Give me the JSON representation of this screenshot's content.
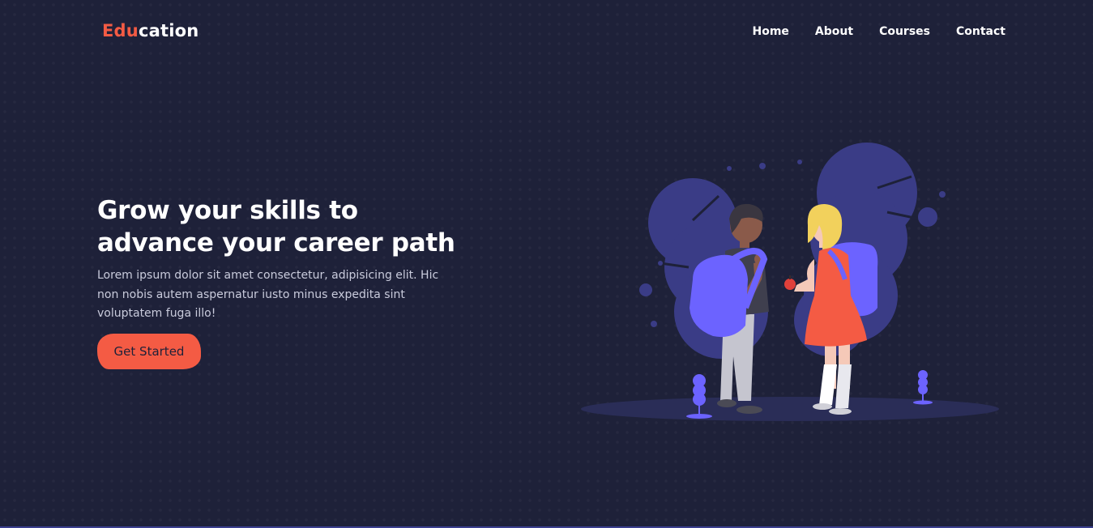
{
  "header": {
    "logo_accent": "Edu",
    "logo_rest": "cation",
    "nav": [
      {
        "label": "Home"
      },
      {
        "label": "About"
      },
      {
        "label": "Courses"
      },
      {
        "label": "Contact"
      }
    ]
  },
  "hero": {
    "title_line1": "Grow your skills to",
    "title_line2": "advance your career path",
    "description": "Lorem ipsum dolor sit amet consectetur, adipisicing elit. Hic non nobis autem aspernatur iusto minus expedita sint voluptatem fuga illo!",
    "cta_label": "Get Started"
  },
  "colors": {
    "background": "#1e2139",
    "accent": "#f45b44",
    "illustration_primary": "#6c63ff",
    "text": "#ffffff"
  },
  "illustration": {
    "icon": "students-with-backpacks-illustration"
  }
}
